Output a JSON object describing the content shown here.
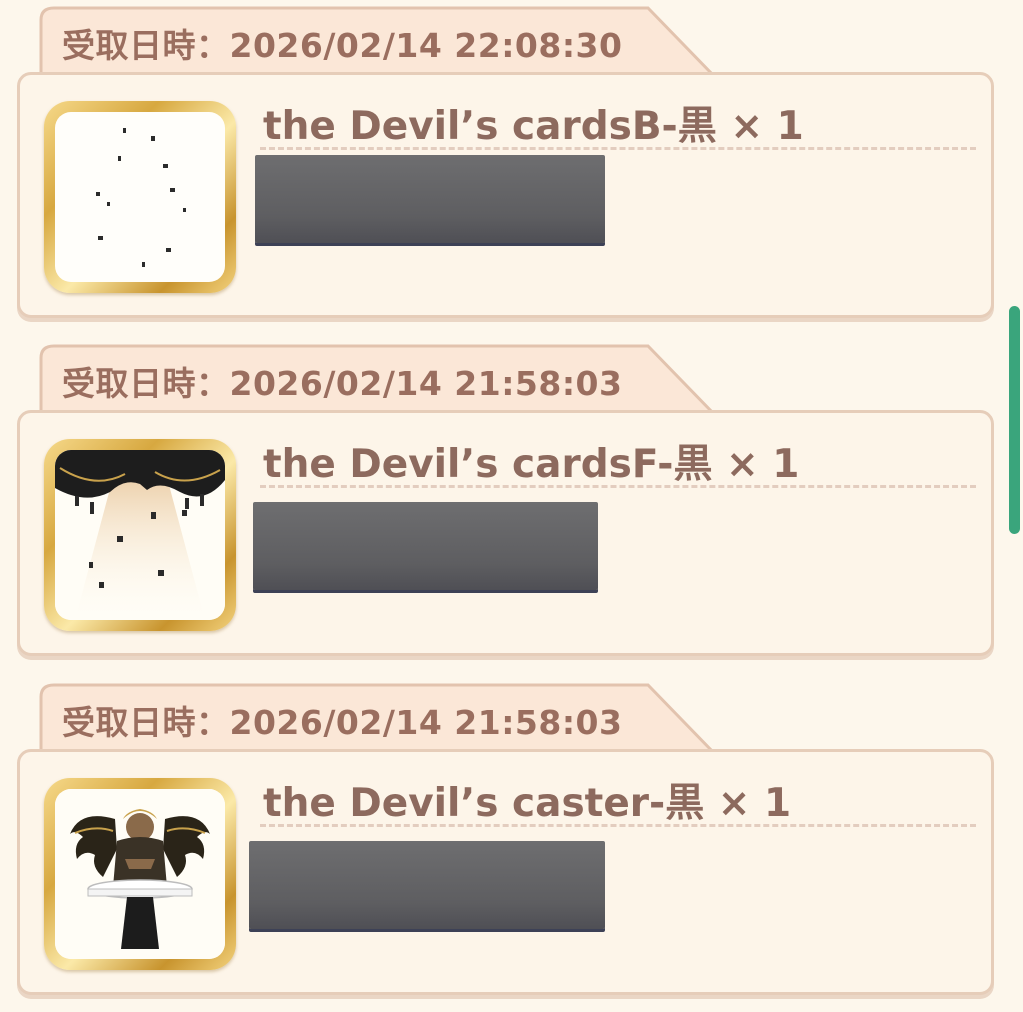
{
  "history": [
    {
      "received_label": "受取日時：2026/02/14 22:08:30",
      "item_name": "the Devil’s cardsB-黒 × 1",
      "icon": "scattered-cards-icon"
    },
    {
      "received_label": "受取日時：2026/02/14 21:58:03",
      "item_name": "the Devil’s cardsF-黒 × 1",
      "icon": "curtain-cards-icon"
    },
    {
      "received_label": "受取日時：2026/02/14 21:58:03",
      "item_name": "the Devil’s caster-黒 × 1",
      "icon": "winged-caster-icon"
    }
  ],
  "colors": {
    "background": "#fdf7ec",
    "tab_fill": "#fbe7d7",
    "card_border": "#e6cdb9",
    "text": "#8d6a5e",
    "scrollbar": "#3aa57c",
    "redaction": "#606063"
  }
}
